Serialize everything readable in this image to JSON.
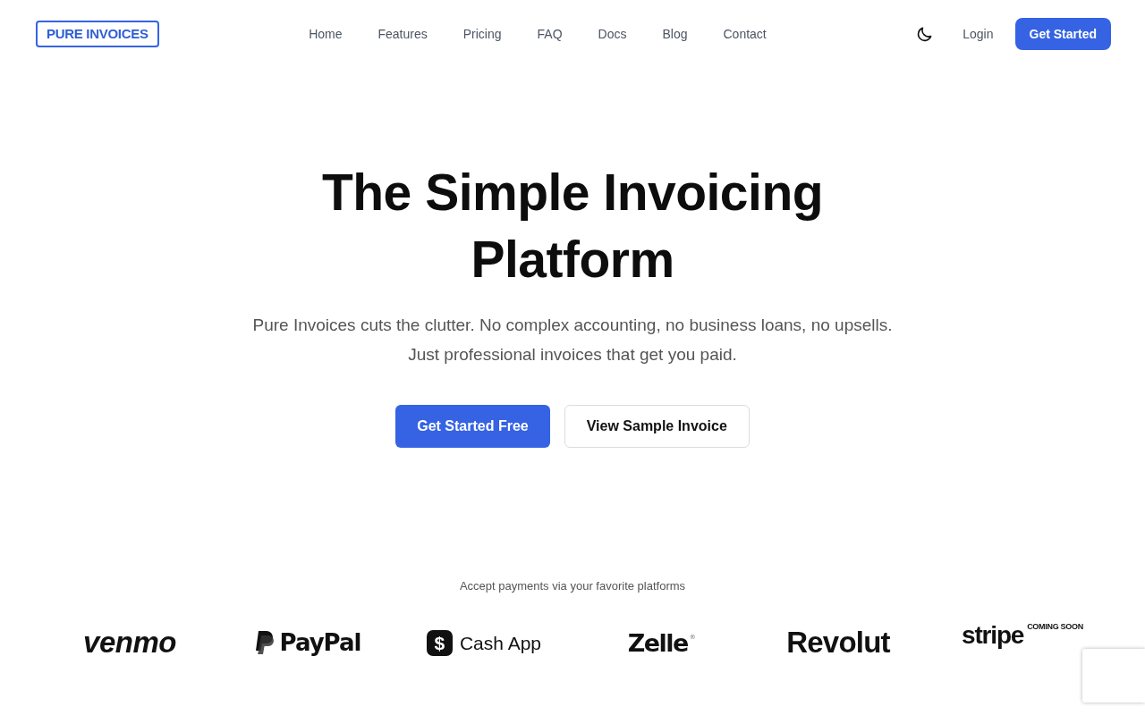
{
  "brand": {
    "logo": "PURE INVOICES"
  },
  "nav": {
    "links": [
      "Home",
      "Features",
      "Pricing",
      "FAQ",
      "Docs",
      "Blog",
      "Contact"
    ]
  },
  "header_actions": {
    "login": "Login",
    "cta": "Get Started"
  },
  "hero": {
    "title": "The Simple Invoicing Platform",
    "subtitle": "Pure Invoices cuts the clutter. No complex accounting, no business loans, no upsells. Just professional invoices that get you paid.",
    "buttons": [
      {
        "label": "Get Started Free",
        "kind": "primary"
      },
      {
        "label": "View Sample Invoice",
        "kind": "secondary"
      }
    ]
  },
  "payments": {
    "heading": "Accept payments via your favorite platforms",
    "platforms": [
      {
        "kind": "venmo",
        "name": "venmo"
      },
      {
        "kind": "paypal",
        "name": "PayPal"
      },
      {
        "kind": "cashapp",
        "name": "Cash App",
        "icon": "$"
      },
      {
        "kind": "zelle",
        "name": "Zelle$^{®}$"
      },
      {
        "kind": "revolut",
        "name": "Revolut"
      },
      {
        "kind": "stripe",
        "name": "stripe",
        "badge": "COMING SOON"
      }
    ]
  }
}
